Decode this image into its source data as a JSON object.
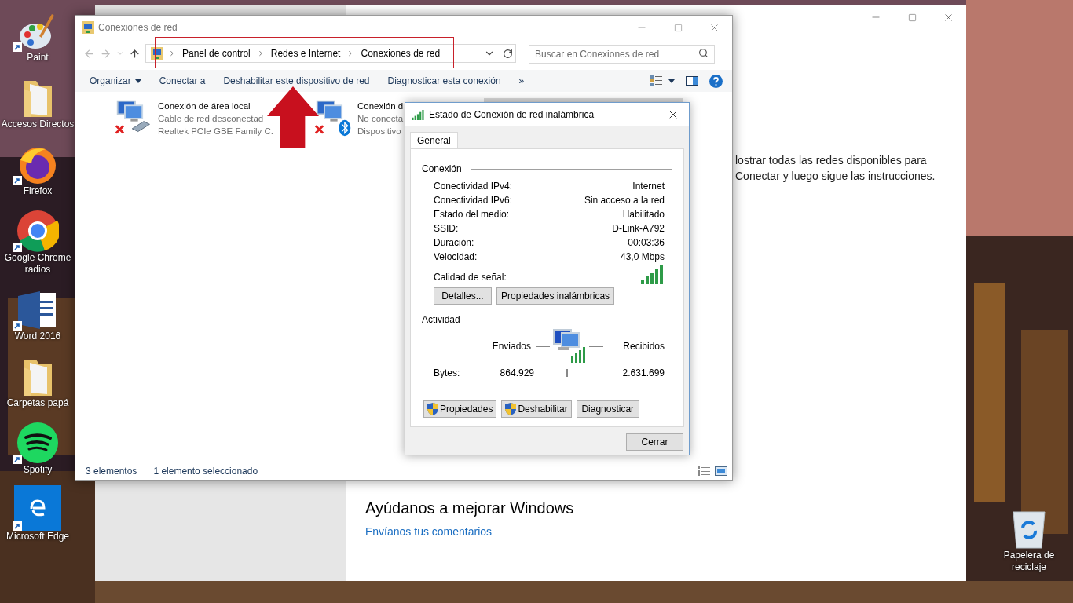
{
  "desktop_icons": [
    {
      "label": "Paint",
      "kind": "paint",
      "shortcut": true
    },
    {
      "label": "Accesos Directos",
      "kind": "folder",
      "shortcut": false
    },
    {
      "label": "Firefox",
      "kind": "firefox",
      "shortcut": true
    },
    {
      "label": "Google Chrome radios",
      "kind": "chrome",
      "shortcut": true
    },
    {
      "label": "Word 2016",
      "kind": "word",
      "shortcut": true
    },
    {
      "label": "Carpetas papá",
      "kind": "folder",
      "shortcut": false
    },
    {
      "label": "Spotify",
      "kind": "spotify",
      "shortcut": true
    },
    {
      "label": "Microsoft Edge",
      "kind": "edge",
      "shortcut": true
    }
  ],
  "recycle_bin": {
    "label": "Papelera de reciclaje"
  },
  "settings_window": {
    "text_lines": [
      "lostrar todas las redes disponibles para",
      "Conectar y luego sigue las instrucciones."
    ],
    "feedback_heading": "Ayúdanos a mejorar Windows",
    "feedback_link": "Envíanos tus comentarios"
  },
  "explorer": {
    "title": "Conexiones de red",
    "breadcrumb": [
      "Panel de control",
      "Redes e Internet",
      "Conexiones de red"
    ],
    "search": {
      "placeholder": "Buscar en Conexiones de red"
    },
    "toolbar": [
      {
        "label": "Organizar",
        "kind": "menu"
      },
      {
        "label": "Conectar a",
        "kind": "command"
      },
      {
        "label": "Deshabilitar este dispositivo de red",
        "kind": "command"
      },
      {
        "label": "Diagnosticar esta conexión",
        "kind": "command"
      },
      {
        "label": "»",
        "kind": "command"
      }
    ],
    "items": [
      {
        "name": "Conexión de área local",
        "status": "Cable de red desconectad",
        "device": "Realtek PCIe GBE Family C.",
        "kind": "ethernet",
        "disconnected": true,
        "selected": false
      },
      {
        "name": "Conexión d",
        "status": "No conecta",
        "device": "Dispositivo",
        "kind": "bluetooth",
        "disconnected": true,
        "selected": false
      },
      {
        "selected": true
      }
    ],
    "status_bar": [
      "3 elementos",
      "1 elemento seleccionado"
    ]
  },
  "dialog": {
    "title": "Estado de Conexión de red inalámbrica",
    "tabs": [
      {
        "label": "General",
        "selected": true
      }
    ],
    "connection": {
      "heading": "Conexión",
      "rows": [
        {
          "label": "Conectividad IPv4:",
          "value": "Internet"
        },
        {
          "label": "Conectividad IPv6:",
          "value": "Sin acceso a la red"
        },
        {
          "label": "Estado del medio:",
          "value": "Habilitado"
        },
        {
          "label": "SSID:",
          "value": "D-Link-A792"
        },
        {
          "label": "Duración:",
          "value": "00:03:36"
        },
        {
          "label": "Velocidad:",
          "value": "43,0 Mbps"
        }
      ],
      "signal_label": "Calidad de señal:",
      "buttons": [
        "Detalles...",
        "Propiedades inalámbricas"
      ]
    },
    "activity": {
      "heading": "Actividad",
      "sent_label": "Enviados",
      "received_label": "Recibidos",
      "bytes_label": "Bytes:",
      "sent": "864.929",
      "received": "2.631.699"
    },
    "buttons": [
      {
        "label": "Propiedades",
        "shield": true
      },
      {
        "label": "Deshabilitar",
        "shield": true
      },
      {
        "label": "Diagnosticar",
        "shield": false
      }
    ],
    "close_button": "Cerrar"
  }
}
